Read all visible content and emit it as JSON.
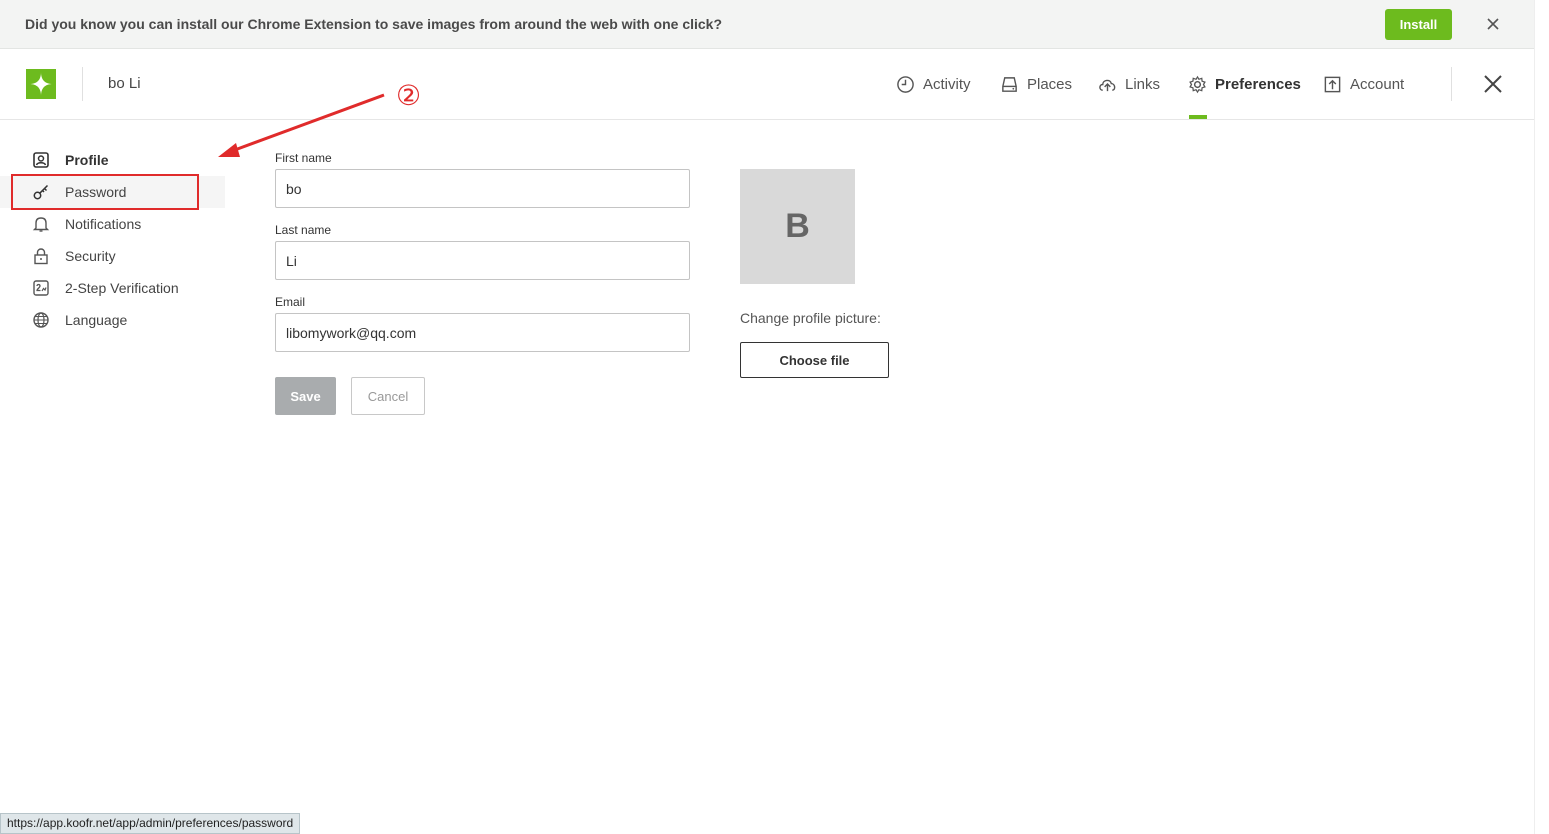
{
  "banner": {
    "text": "Did you know you can install our Chrome Extension to save images from around the web with one click?",
    "install_label": "Install"
  },
  "header": {
    "username": "bo Li",
    "nav": [
      {
        "label": "Activity",
        "icon": "clock-icon"
      },
      {
        "label": "Places",
        "icon": "drive-icon"
      },
      {
        "label": "Links",
        "icon": "cloud-upload-icon"
      },
      {
        "label": "Preferences",
        "icon": "gear-icon",
        "active": true
      },
      {
        "label": "Account",
        "icon": "upload-box-icon"
      }
    ]
  },
  "sidebar": {
    "items": [
      {
        "label": "Profile",
        "icon": "user-card-icon"
      },
      {
        "label": "Password",
        "icon": "key-icon"
      },
      {
        "label": "Notifications",
        "icon": "bell-icon"
      },
      {
        "label": "Security",
        "icon": "lock-icon"
      },
      {
        "label": "2-Step Verification",
        "icon": "two-step-icon"
      },
      {
        "label": "Language",
        "icon": "globe-icon"
      }
    ]
  },
  "annotation": {
    "step": "②"
  },
  "form": {
    "first_name_label": "First name",
    "first_name_value": "bo",
    "last_name_label": "Last name",
    "last_name_value": "Li",
    "email_label": "Email",
    "email_value": "libomywork@qq.com",
    "save_label": "Save",
    "cancel_label": "Cancel"
  },
  "profile_picture": {
    "initial": "B",
    "change_label": "Change profile picture:",
    "choose_label": "Choose file"
  },
  "status_bar": {
    "url": "https://app.koofr.net/app/admin/preferences/password"
  },
  "colors": {
    "accent": "#6dbb1e",
    "annotation": "#e02b2b"
  }
}
